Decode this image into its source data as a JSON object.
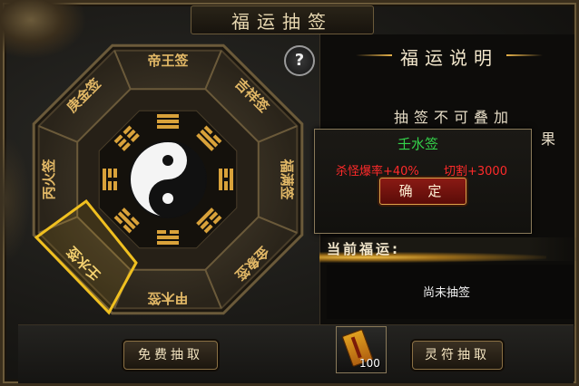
{
  "window": {
    "title": "福运抽签",
    "close_icon": "close-icon"
  },
  "help": {
    "label": "?"
  },
  "wheel": {
    "slots": [
      "帝王签",
      "吉祥签",
      "福满签",
      "金象签",
      "甲木签",
      "壬水签",
      "丙火签",
      "庚金签"
    ],
    "selected": "壬水签"
  },
  "info": {
    "title": "福运说明",
    "line1": "抽签不可叠加",
    "line_cut": "果"
  },
  "popup": {
    "name": "壬水签",
    "stat1": "杀怪爆率+40%",
    "stat2": "切割+3000",
    "confirm": "确 定"
  },
  "fortune": {
    "label": "当前福运:",
    "value": "尚未抽签"
  },
  "buttons": {
    "free": "免费抽取",
    "talisman": "灵符抽取"
  },
  "item": {
    "count": "100",
    "icon": "talisman-icon"
  },
  "colors": {
    "accent_gold": "#e0b24a",
    "green": "#34d24a",
    "red": "#ff2a2a"
  }
}
